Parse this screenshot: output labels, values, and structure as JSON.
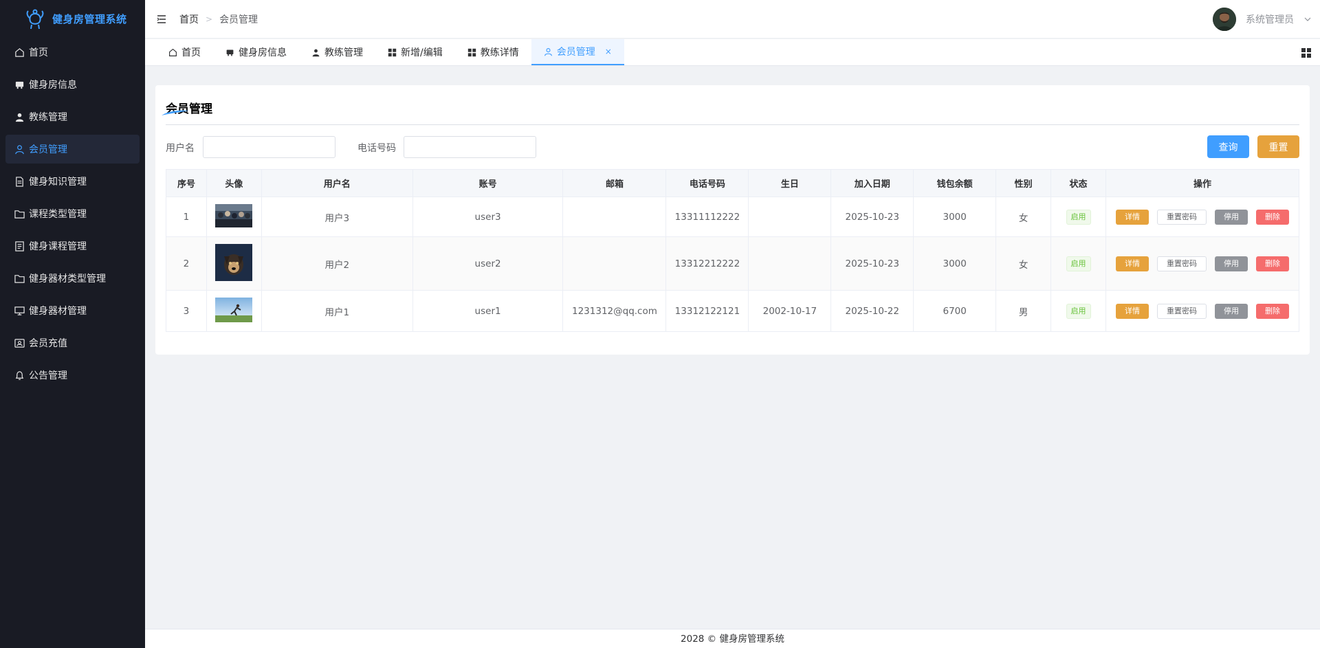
{
  "app": {
    "title": "健身房管理系统",
    "brand_color": "#409eff"
  },
  "sidebar": {
    "items": [
      {
        "label": "首页",
        "icon": "home-icon"
      },
      {
        "label": "健身房信息",
        "icon": "building-icon"
      },
      {
        "label": "教练管理",
        "icon": "user-icon"
      },
      {
        "label": "会员管理",
        "icon": "user-outline-icon",
        "active": true
      },
      {
        "label": "健身知识管理",
        "icon": "document-icon"
      },
      {
        "label": "课程类型管理",
        "icon": "folder-icon"
      },
      {
        "label": "健身课程管理",
        "icon": "document-list-icon"
      },
      {
        "label": "健身器材类型管理",
        "icon": "folder-icon"
      },
      {
        "label": "健身器材管理",
        "icon": "monitor-icon"
      },
      {
        "label": "会员充值",
        "icon": "wallet-icon"
      },
      {
        "label": "公告管理",
        "icon": "bell-icon"
      }
    ]
  },
  "header": {
    "breadcrumb_home": "首页",
    "breadcrumb_current": "会员管理",
    "user_name": "系统管理员"
  },
  "tabs": [
    {
      "label": "首页",
      "icon": "home-icon"
    },
    {
      "label": "健身房信息",
      "icon": "building-icon"
    },
    {
      "label": "教练管理",
      "icon": "user-icon"
    },
    {
      "label": "新增/编辑",
      "icon": "grid-icon"
    },
    {
      "label": "教练详情",
      "icon": "grid-icon"
    },
    {
      "label": "会员管理",
      "icon": "user-outline-icon",
      "active": true,
      "close": "×"
    }
  ],
  "page": {
    "title": "会员管理",
    "search": {
      "username_label": "用户名",
      "username_value": "",
      "phone_label": "电话号码",
      "phone_value": "",
      "query_btn": "查询",
      "reset_btn": "重置"
    },
    "table": {
      "headers": [
        "序号",
        "头像",
        "用户名",
        "账号",
        "邮箱",
        "电话号码",
        "生日",
        "加入日期",
        "钱包余额",
        "性别",
        "状态",
        "操作"
      ],
      "rows": [
        {
          "no": "1",
          "avatar": "crowd-photo",
          "username": "用户3",
          "account": "user3",
          "email": "",
          "phone": "13311112222",
          "birthday": "",
          "join_date": "2025-10-23",
          "balance": "3000",
          "gender": "女",
          "status": "启用"
        },
        {
          "no": "2",
          "avatar": "dog-photo",
          "username": "用户2",
          "account": "user2",
          "email": "",
          "phone": "13312212222",
          "birthday": "",
          "join_date": "2025-10-23",
          "balance": "3000",
          "gender": "女",
          "status": "启用"
        },
        {
          "no": "3",
          "avatar": "runner-photo",
          "username": "用户1",
          "account": "user1",
          "email": "1231312@qq.com",
          "phone": "13312122121",
          "birthday": "2002-10-17",
          "join_date": "2025-10-22",
          "balance": "6700",
          "gender": "男",
          "status": "启用"
        }
      ],
      "actions": {
        "detail": "详情",
        "reset_pwd": "重置密码",
        "disable": "停用",
        "delete": "删除"
      }
    }
  },
  "footer": {
    "text": "2028 © 健身房管理系统"
  }
}
